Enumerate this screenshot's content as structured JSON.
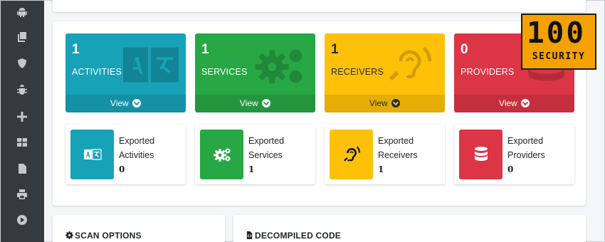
{
  "sidebar": {
    "icons": [
      "android-icon",
      "copy-icon",
      "shield-icon",
      "bug-icon",
      "plus-icon",
      "windows-icon",
      "pdf-file-icon",
      "print-icon",
      "play-circle-icon"
    ]
  },
  "small_boxes": [
    {
      "count": "1",
      "label": "ACTIVITIES",
      "footer": "View",
      "color": "#17a2b8",
      "icon": "language-icon"
    },
    {
      "count": "1",
      "label": "SERVICES",
      "footer": "View",
      "color": "#28a745",
      "icon": "cogs-icon"
    },
    {
      "count": "1",
      "label": "RECEIVERS",
      "footer": "View",
      "color": "#ffc107",
      "icon": "assistive-listening-icon"
    },
    {
      "count": "0",
      "label": "PROVIDERS",
      "footer": "View",
      "color": "#dc3545",
      "icon": "database-icon"
    }
  ],
  "info_boxes": [
    {
      "line1": "Exported",
      "line2": "Activities",
      "count": "0",
      "color": "#17a2b8",
      "icon": "language-icon"
    },
    {
      "line1": "Exported",
      "line2": "Services",
      "count": "1",
      "color": "#28a745",
      "icon": "cogs-icon"
    },
    {
      "line1": "Exported",
      "line2": "Receivers",
      "count": "1",
      "color": "#ffc107",
      "icon": "assistive-listening-icon"
    },
    {
      "line1": "Exported",
      "line2": "Providers",
      "count": "0",
      "color": "#dc3545",
      "icon": "database-icon"
    }
  ],
  "panels": {
    "scan_options": "SCAN OPTIONS",
    "decompiled_code": "DECOMPILED CODE"
  },
  "logo": {
    "line1": "100",
    "line2": "SECURITY"
  }
}
